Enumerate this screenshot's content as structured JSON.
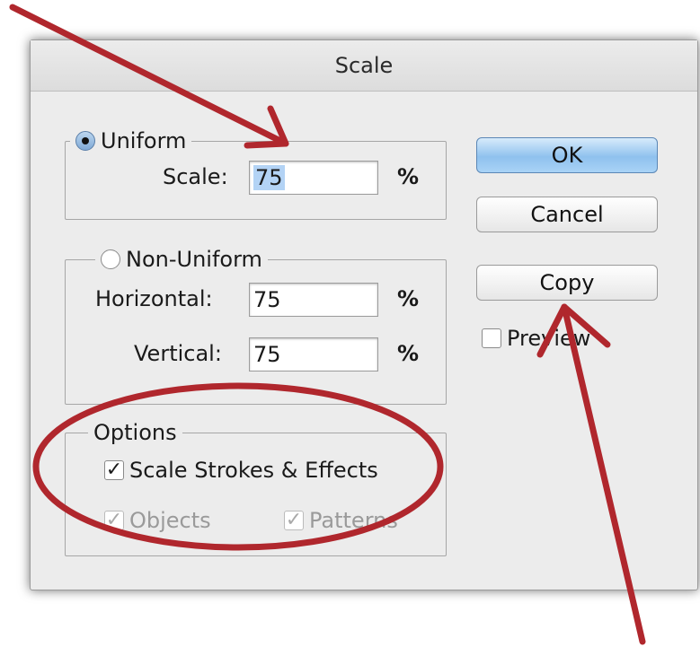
{
  "window": {
    "title": "Scale"
  },
  "uniform": {
    "label": "Uniform",
    "selected": true,
    "scale_label": "Scale:",
    "scale_value": "75",
    "unit": "%"
  },
  "non_uniform": {
    "label": "Non-Uniform",
    "selected": false,
    "horizontal_label": "Horizontal:",
    "horizontal_value": "75",
    "vertical_label": "Vertical:",
    "vertical_value": "75",
    "unit": "%"
  },
  "options": {
    "label": "Options",
    "scale_strokes_label": "Scale Strokes & Effects",
    "scale_strokes_checked": true,
    "objects_label": "Objects",
    "objects_checked": true,
    "patterns_label": "Patterns",
    "patterns_checked": true
  },
  "buttons": {
    "ok": "OK",
    "cancel": "Cancel",
    "copy": "Copy"
  },
  "preview": {
    "label": "Preview",
    "checked": false
  },
  "annotation": {
    "color": "#b0272d"
  },
  "icons": {
    "check": "checkmark-icon",
    "radio_on": "radio-selected-icon",
    "radio_off": "radio-unselected-icon"
  }
}
